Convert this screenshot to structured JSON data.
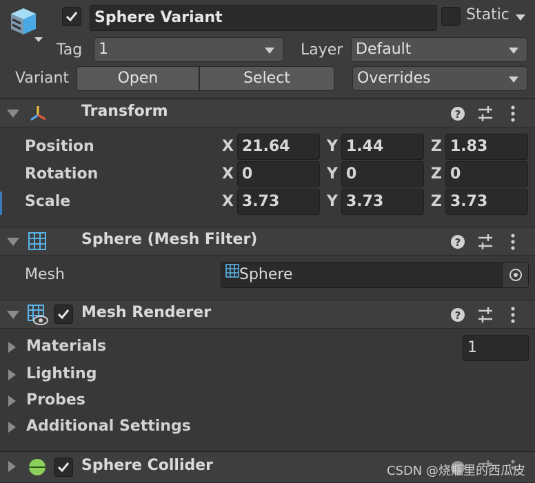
{
  "header": {
    "name_value": "Sphere Variant",
    "static_label": "Static",
    "tag_label": "Tag",
    "tag_value": "1",
    "layer_label": "Layer",
    "layer_value": "Default",
    "variant_label": "Variant",
    "open_label": "Open",
    "select_label": "Select",
    "overrides_label": "Overrides"
  },
  "transform": {
    "title": "Transform",
    "rows": [
      {
        "label": "Position",
        "x": "21.64",
        "y": "1.44",
        "z": "1.83"
      },
      {
        "label": "Rotation",
        "x": "0",
        "y": "0",
        "z": "0"
      },
      {
        "label": "Scale",
        "x": "3.73",
        "y": "3.73",
        "z": "3.73"
      }
    ],
    "axis_x": "X",
    "axis_y": "Y",
    "axis_z": "Z"
  },
  "mesh_filter": {
    "title": "Sphere (Mesh Filter)",
    "mesh_label": "Mesh",
    "mesh_value": "Sphere"
  },
  "mesh_renderer": {
    "title": "Mesh Renderer",
    "materials_label": "Materials",
    "materials_count": "1",
    "lighting_label": "Lighting",
    "probes_label": "Probes",
    "additional_label": "Additional Settings"
  },
  "sphere_collider": {
    "title": "Sphere Collider"
  },
  "watermark": "CSDN @烧瓶里的西瓜皮",
  "colors": {
    "background": "#383838",
    "header": "#3e3e3e",
    "field": "#2a2a2a",
    "accent_selected": "#3a79bb",
    "collider_green": "#8bd15b"
  },
  "icons": [
    "prefab-variant-icon",
    "checkmark-icon",
    "help-icon",
    "presets-icon",
    "menu-kebab-icon",
    "transform-axes-icon",
    "mesh-grid-icon",
    "mesh-renderer-icon",
    "object-picker-icon",
    "sphere-collider-icon"
  ]
}
